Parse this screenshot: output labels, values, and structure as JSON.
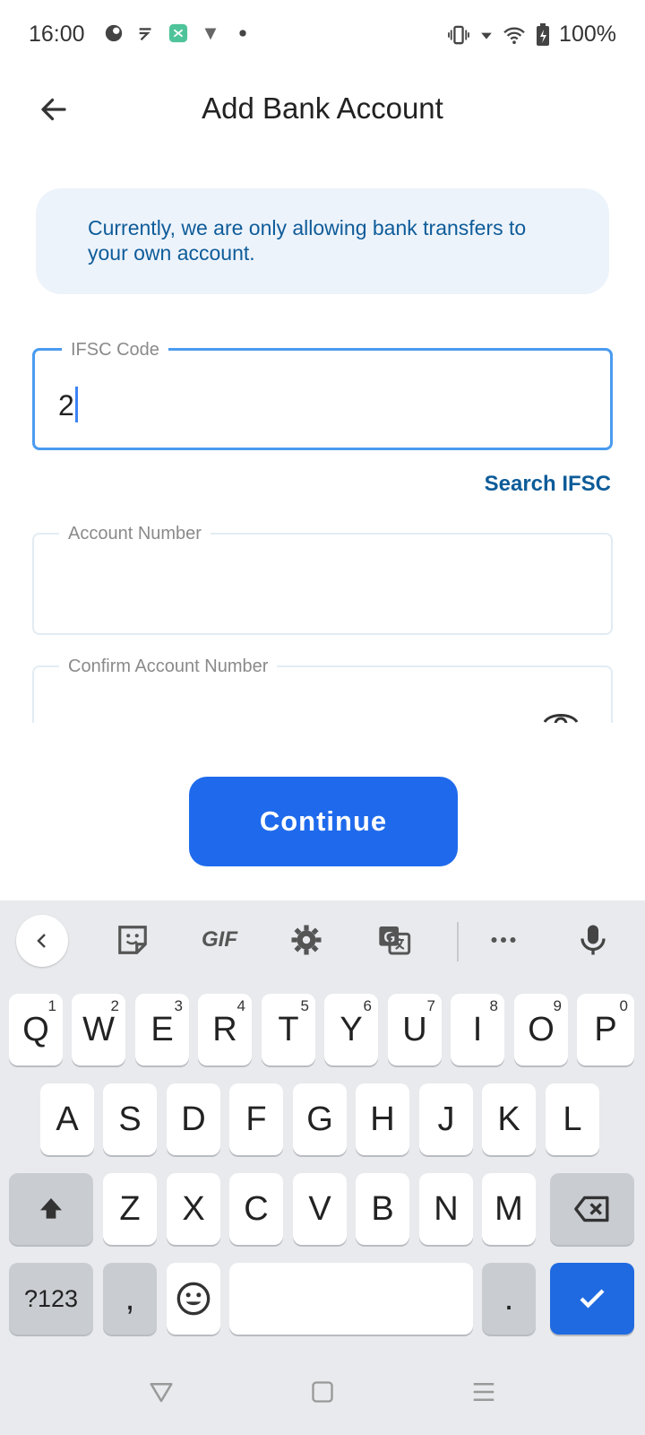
{
  "status_bar": {
    "time": "16:00",
    "battery": "100%",
    "icons_left": [
      "cloud-icon",
      "rupee-app-icon",
      "calculator-app-icon",
      "diamond-app-icon",
      "dot-icon"
    ],
    "icons_right": [
      "vibrate-icon",
      "signal-icon",
      "wifi-icon",
      "battery-charging-icon"
    ]
  },
  "header": {
    "title": "Add Bank Account",
    "back_icon": "arrow-left-icon"
  },
  "info": {
    "message": "Currently, we are only allowing bank transfers to your own account."
  },
  "form": {
    "ifsc": {
      "label": "IFSC Code",
      "value": "2"
    },
    "search_ifsc": "Search IFSC",
    "account_number": {
      "label": "Account Number",
      "value": ""
    },
    "confirm_account_number": {
      "label": "Confirm Account Number",
      "value": "",
      "toggle_icon": "eye-icon"
    }
  },
  "actions": {
    "continue_label": "Continue"
  },
  "keyboard": {
    "toolbar": [
      "collapse-icon",
      "sticker-icon",
      "GIF",
      "gear-icon",
      "translate-icon",
      "more-icon",
      "microphone-icon"
    ],
    "gif_label": "GIF",
    "row1": [
      {
        "key": "Q",
        "hint": "1"
      },
      {
        "key": "W",
        "hint": "2"
      },
      {
        "key": "E",
        "hint": "3"
      },
      {
        "key": "R",
        "hint": "4"
      },
      {
        "key": "T",
        "hint": "5"
      },
      {
        "key": "Y",
        "hint": "6"
      },
      {
        "key": "U",
        "hint": "7"
      },
      {
        "key": "I",
        "hint": "8"
      },
      {
        "key": "O",
        "hint": "9"
      },
      {
        "key": "P",
        "hint": "0"
      }
    ],
    "row2": [
      "A",
      "S",
      "D",
      "F",
      "G",
      "H",
      "J",
      "K",
      "L"
    ],
    "row3": [
      "Z",
      "X",
      "C",
      "V",
      "B",
      "N",
      "M"
    ],
    "row4": {
      "symbols": "?123",
      "comma": ",",
      "period": "."
    }
  },
  "colors": {
    "primary": "#1f6aec",
    "info_bg": "#edf3fb",
    "info_text": "#0e5c99",
    "focus_border": "#4a9bf0",
    "keyboard_bg": "#e8eaed"
  }
}
